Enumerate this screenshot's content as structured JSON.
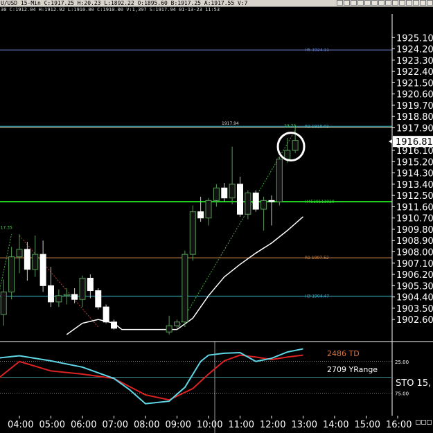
{
  "header": {
    "quote_text": "U/USD  15-Min  C:1917.25  H:20.23  L:1892.22  O:1895.60  B:1917.25  A:1917.55  V:7",
    "info_text": "30  C:1912.04  H:1912.92  L:1910.00  C:1910.00  V:1,397  S:1917.94  01-13-23  11:53",
    "toolbar_icons": [
      "chart-icon",
      "arrow-icon",
      "check-icon",
      "draw-icon",
      "pen-icon",
      "flag-icon",
      "circle-icon",
      "target-icon",
      "line-icon",
      "tag-icon",
      "box-icon",
      "grid-icon",
      "text-icon",
      "close-icon"
    ]
  },
  "colors": {
    "background": "#000000",
    "up_candle": "#111111",
    "up_border": "#5a9a5a",
    "down_candle": "#ffffff",
    "h5": "#6a7fd0",
    "r2": "#3ab4c8",
    "r1": "#d08a4a",
    "h3": "#3ab4c8",
    "h4_green": "#22dd22",
    "ma_white": "#ffffff",
    "sto_cyan": "#5fd7e6",
    "sto_red": "#dd2222",
    "price_line": "#e8e6b8"
  },
  "chart_data": {
    "type": "candlestick",
    "y_range": [
      1902.0,
      1926.0
    ],
    "y_ticks": [
      "1925.10",
      "1924.20",
      "1923.30",
      "1922.40",
      "1921.50",
      "1920.60",
      "1919.70",
      "1918.80",
      "1917.90",
      "1916.10",
      "1915.20",
      "1914.30",
      "1913.40",
      "1912.50",
      "1911.60",
      "1910.70",
      "1909.80",
      "1908.90",
      "1908.00",
      "1907.10",
      "1906.20",
      "1905.30",
      "1904.40",
      "1903.50",
      "1902.60"
    ],
    "x_ticks": [
      "04:00",
      "05:00",
      "06:00",
      "07:00",
      "08:00",
      "09:00",
      "10:00",
      "11:00",
      "12:00",
      "13:00",
      "14:00",
      "15:00",
      "16:00"
    ],
    "current_price_label": "1916.81",
    "current_price": 1916.81,
    "levels": [
      {
        "label": "H5 1924.11",
        "value": 1924.11,
        "color_key": "h5"
      },
      {
        "label": "R2 1918.02",
        "value": 1918.02,
        "color_key": "r2"
      },
      {
        "label": "H4519111920",
        "value": 1912.0,
        "color_key": "h4_green"
      },
      {
        "label": "R1 1907.52",
        "value": 1907.52,
        "color_key": "r1"
      },
      {
        "label": "H3 1904.47",
        "value": 1904.47,
        "color_key": "h3"
      }
    ],
    "price_line": {
      "value": 1917.94,
      "label": "1917.94"
    },
    "annotations": [
      {
        "text": "17.35",
        "x_time": "03:45",
        "y": 1909.6,
        "color": "#5acd5a"
      },
      {
        "text": "23.73",
        "x_time": "12:45",
        "y": 1917.7,
        "color": "#5acd5a"
      }
    ],
    "candles": [
      {
        "t": "03:30",
        "o": 1903.0,
        "h": 1905.8,
        "l": 1902.1,
        "c": 1904.8
      },
      {
        "t": "03:45",
        "o": 1904.8,
        "h": 1908.4,
        "l": 1904.2,
        "c": 1907.6
      },
      {
        "t": "04:00",
        "o": 1907.6,
        "h": 1909.4,
        "l": 1906.3,
        "c": 1908.2
      },
      {
        "t": "04:15",
        "o": 1908.2,
        "h": 1908.8,
        "l": 1905.7,
        "c": 1906.6
      },
      {
        "t": "04:30",
        "o": 1906.6,
        "h": 1909.3,
        "l": 1906.0,
        "c": 1907.8
      },
      {
        "t": "04:45",
        "o": 1907.8,
        "h": 1908.9,
        "l": 1904.8,
        "c": 1905.3
      },
      {
        "t": "05:00",
        "o": 1905.3,
        "h": 1906.8,
        "l": 1903.6,
        "c": 1904.0
      },
      {
        "t": "05:15",
        "o": 1904.0,
        "h": 1905.0,
        "l": 1903.6,
        "c": 1904.5
      },
      {
        "t": "05:30",
        "o": 1904.5,
        "h": 1905.1,
        "l": 1903.8,
        "c": 1904.6
      },
      {
        "t": "05:45",
        "o": 1904.6,
        "h": 1905.1,
        "l": 1903.9,
        "c": 1904.2
      },
      {
        "t": "06:00",
        "o": 1904.2,
        "h": 1906.1,
        "l": 1903.6,
        "c": 1905.9
      },
      {
        "t": "06:15",
        "o": 1905.9,
        "h": 1906.2,
        "l": 1904.3,
        "c": 1904.9
      },
      {
        "t": "06:30",
        "o": 1904.9,
        "h": 1905.1,
        "l": 1903.4,
        "c": 1903.6
      },
      {
        "t": "06:45",
        "o": 1903.6,
        "h": 1903.8,
        "l": 1902.3,
        "c": 1902.4
      },
      {
        "t": "07:00",
        "o": 1902.4,
        "h": 1902.6,
        "l": 1901.8,
        "c": 1901.9
      },
      {
        "t": "08:45",
        "o": 1901.6,
        "h": 1902.9,
        "l": 1901.4,
        "c": 1902.1
      },
      {
        "t": "09:00",
        "o": 1902.1,
        "h": 1902.6,
        "l": 1901.8,
        "c": 1902.4
      },
      {
        "t": "09:15",
        "o": 1902.4,
        "h": 1908.1,
        "l": 1902.0,
        "c": 1907.8
      },
      {
        "t": "09:30",
        "o": 1907.8,
        "h": 1911.7,
        "l": 1907.3,
        "c": 1911.2
      },
      {
        "t": "09:45",
        "o": 1911.2,
        "h": 1912.4,
        "l": 1910.4,
        "c": 1910.7
      },
      {
        "t": "10:00",
        "o": 1910.7,
        "h": 1912.3,
        "l": 1910.1,
        "c": 1912.1
      },
      {
        "t": "10:15",
        "o": 1912.1,
        "h": 1913.4,
        "l": 1911.6,
        "c": 1913.1
      },
      {
        "t": "10:30",
        "o": 1913.1,
        "h": 1913.5,
        "l": 1912.0,
        "c": 1912.3
      },
      {
        "t": "10:45",
        "o": 1912.3,
        "h": 1916.4,
        "l": 1911.8,
        "c": 1913.4
      },
      {
        "t": "11:00",
        "o": 1913.4,
        "h": 1914.0,
        "l": 1910.8,
        "c": 1911.0
      },
      {
        "t": "11:15",
        "o": 1911.0,
        "h": 1912.9,
        "l": 1910.6,
        "c": 1912.7
      },
      {
        "t": "11:30",
        "o": 1912.7,
        "h": 1912.9,
        "l": 1911.2,
        "c": 1911.4
      },
      {
        "t": "11:45",
        "o": 1911.4,
        "h": 1912.4,
        "l": 1909.7,
        "c": 1912.1
      },
      {
        "t": "12:00",
        "o": 1912.1,
        "h": 1912.5,
        "l": 1910.1,
        "c": 1912.0
      },
      {
        "t": "12:15",
        "o": 1912.0,
        "h": 1915.6,
        "l": 1911.7,
        "c": 1915.4
      },
      {
        "t": "12:30",
        "o": 1915.4,
        "h": 1917.1,
        "l": 1915.1,
        "c": 1916.1
      },
      {
        "t": "12:45",
        "o": 1916.1,
        "h": 1917.9,
        "l": 1915.9,
        "c": 1916.9
      }
    ],
    "moving_average": [
      {
        "t": "05:30",
        "v": 1901.4
      },
      {
        "t": "06:00",
        "v": 1902.3
      },
      {
        "t": "06:30",
        "v": 1902.6
      },
      {
        "t": "07:00",
        "v": 1902.3
      },
      {
        "t": "07:15",
        "v": 1901.8
      },
      {
        "t": "09:00",
        "v": 1901.8
      },
      {
        "t": "09:30",
        "v": 1902.7
      },
      {
        "t": "10:00",
        "v": 1904.5
      },
      {
        "t": "10:30",
        "v": 1906.0
      },
      {
        "t": "11:00",
        "v": 1907.0
      },
      {
        "t": "11:30",
        "v": 1907.9
      },
      {
        "t": "12:00",
        "v": 1908.7
      },
      {
        "t": "12:30",
        "v": 1909.7
      },
      {
        "t": "13:00",
        "v": 1910.8
      }
    ],
    "oscillator": {
      "y_ticks": [
        "25.00",
        "75.00"
      ],
      "y_range": [
        0,
        100
      ],
      "label_td": "2486 TD",
      "label_yrange": "2709 YRange",
      "label_sto": "STO  15,",
      "cyan_series": [
        {
          "t": "03:15",
          "v": 20
        },
        {
          "t": "04:00",
          "v": 16
        },
        {
          "t": "05:00",
          "v": 24
        },
        {
          "t": "06:00",
          "v": 34
        },
        {
          "t": "07:00",
          "v": 52
        },
        {
          "t": "07:30",
          "v": 70
        },
        {
          "t": "08:00",
          "v": 92
        },
        {
          "t": "08:45",
          "v": 88
        },
        {
          "t": "09:15",
          "v": 66
        },
        {
          "t": "09:45",
          "v": 25
        },
        {
          "t": "10:00",
          "v": 15
        },
        {
          "t": "10:30",
          "v": 12
        },
        {
          "t": "11:00",
          "v": 11
        },
        {
          "t": "11:30",
          "v": 25
        },
        {
          "t": "12:00",
          "v": 20
        },
        {
          "t": "12:30",
          "v": 10
        },
        {
          "t": "13:00",
          "v": 5
        }
      ],
      "red_series": [
        {
          "t": "03:15",
          "v": 55
        },
        {
          "t": "04:00",
          "v": 25
        },
        {
          "t": "05:00",
          "v": 40
        },
        {
          "t": "06:00",
          "v": 45
        },
        {
          "t": "07:00",
          "v": 52
        },
        {
          "t": "08:00",
          "v": 78
        },
        {
          "t": "08:45",
          "v": 86
        },
        {
          "t": "09:30",
          "v": 68
        },
        {
          "t": "10:00",
          "v": 45
        },
        {
          "t": "10:30",
          "v": 24
        },
        {
          "t": "11:00",
          "v": 15
        },
        {
          "t": "11:30",
          "v": 18
        },
        {
          "t": "12:00",
          "v": 22
        },
        {
          "t": "12:30",
          "v": 18
        },
        {
          "t": "13:00",
          "v": 15
        }
      ]
    }
  }
}
